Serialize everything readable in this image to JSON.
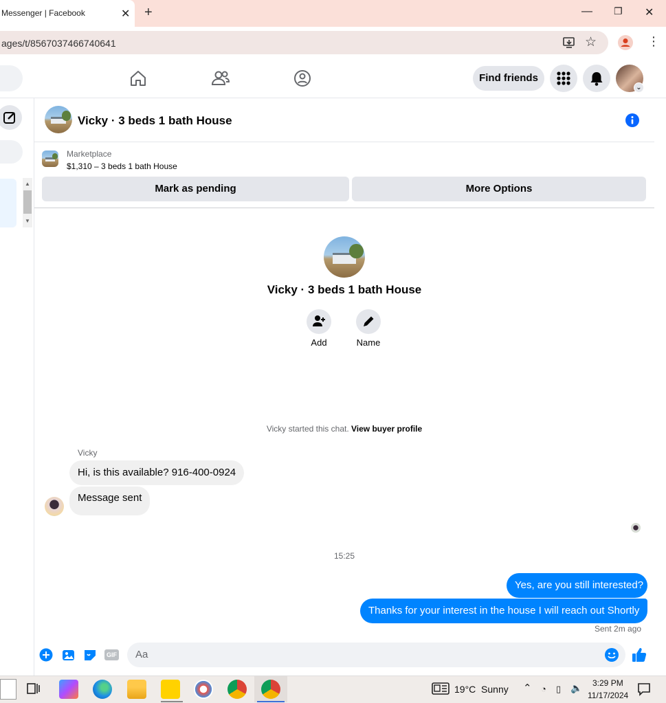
{
  "browser": {
    "tab_title": "Messenger | Facebook",
    "url": "ages/t/8567037466740641"
  },
  "header": {
    "find_friends": "Find friends"
  },
  "conversation": {
    "title": "Vicky · 3 beds 1 bath House",
    "marketplace_label": "Marketplace",
    "listing": "$1,310 – 3 beds 1 bath House",
    "mark_pending": "Mark as pending",
    "more_options": "More Options",
    "profile_name": "Vicky · 3 beds 1 bath House",
    "add_label": "Add",
    "name_label": "Name",
    "started_text": "Vicky started this chat.",
    "view_profile": "View buyer profile",
    "sender_name": "Vicky",
    "timestamp": "15:25",
    "sent_status": "Sent 2m ago",
    "composer_placeholder": "Aa"
  },
  "messages": [
    {
      "from": "Vicky",
      "text": "Hi, is this available? 916-400-0924"
    },
    {
      "from": "Vicky",
      "text": "Message sent"
    },
    {
      "from": "me",
      "text": "Yes, are you still interested?"
    },
    {
      "from": "me",
      "text": "Thanks for your interest in the house I will reach out Shortly"
    }
  ],
  "taskbar": {
    "weather": "19°C  Sunny",
    "time": "3:29 PM",
    "date": "11/17/2024"
  },
  "colors": {
    "accent": "#0084ff",
    "tabbar": "#fbe0d9"
  }
}
